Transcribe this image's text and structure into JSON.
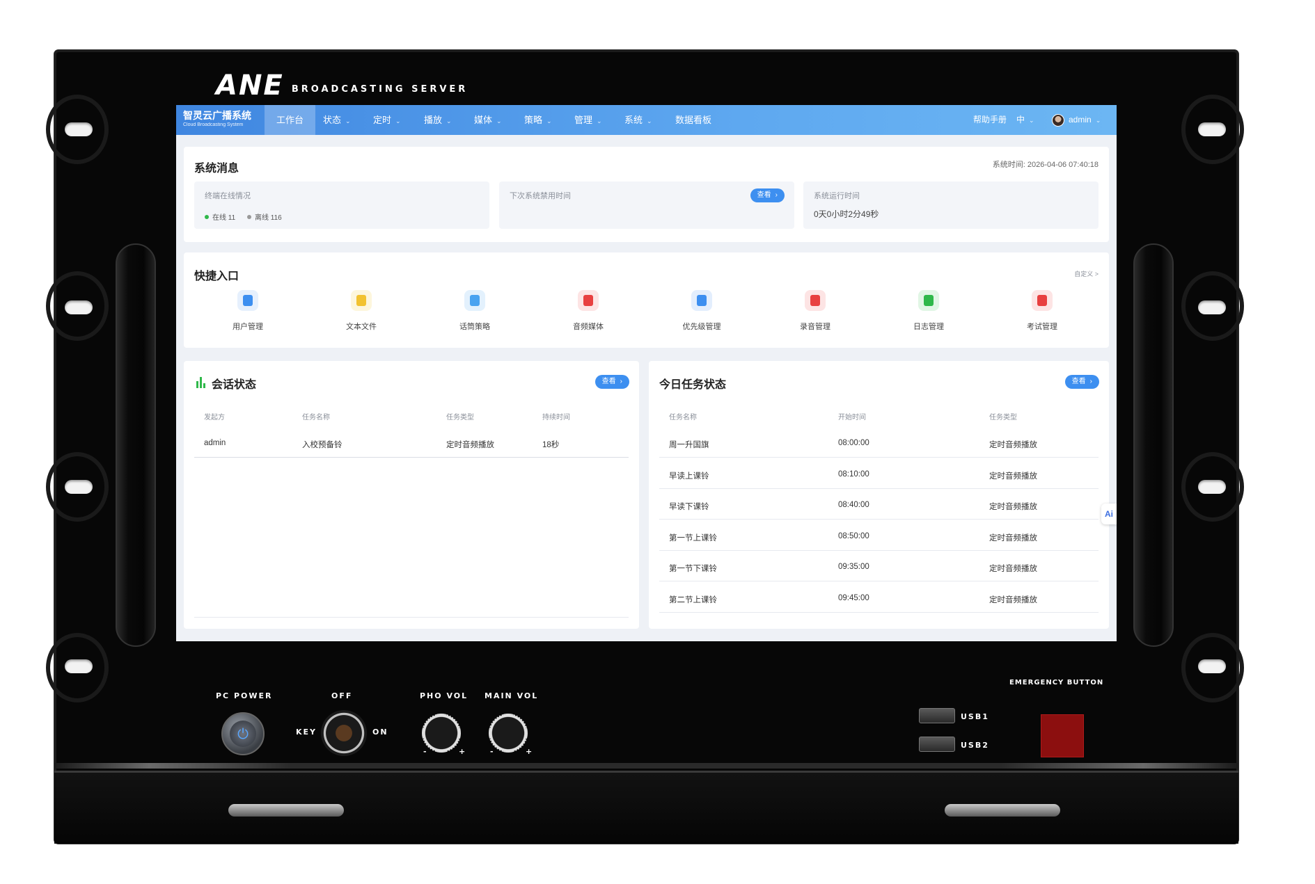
{
  "device": {
    "brand_logo": "ANE",
    "brand_sub": "BROADCASTING SERVER",
    "pc_power": "PC POWER",
    "key_off": "OFF",
    "key_label": "KEY",
    "key_on": "ON",
    "pho_vol": "PHO VOL",
    "main_vol": "MAIN VOL",
    "usb1": "USB1",
    "usb2": "USB2",
    "emergency": "EMERGENCY BUTTON",
    "knob_minus": "-",
    "knob_plus": "+"
  },
  "navbar": {
    "brand_title": "智灵云广播系统",
    "brand_sub": "Cloud Broadcasting System",
    "items": [
      {
        "label": "工作台",
        "active": true
      },
      {
        "label": "状态"
      },
      {
        "label": "定时"
      },
      {
        "label": "播放"
      },
      {
        "label": "媒体"
      },
      {
        "label": "策略"
      },
      {
        "label": "管理"
      },
      {
        "label": "系统"
      },
      {
        "label": "数据看板"
      }
    ],
    "help": "帮助手册",
    "lang": "中",
    "user": "admin"
  },
  "system_msg": {
    "title": "系统消息",
    "time_label": "系统时间: 2026-04-06 07:40:18",
    "terminals_label": "终端在线情况",
    "online": "在线 11",
    "offline": "离线 116",
    "next_disable_label": "下次系统禁用时间",
    "view": "查看",
    "uptime_label": "系统运行时间",
    "uptime_value": "0天0小时2分49秒"
  },
  "quick": {
    "title": "快捷入口",
    "customize": "自定义 >",
    "items": [
      {
        "label": "用户管理",
        "icon": "user-icon",
        "color": "#3d8ff0",
        "bg": "#e6f0fd"
      },
      {
        "label": "文本文件",
        "icon": "text-file-icon",
        "color": "#f2c230",
        "bg": "#fdf6dc"
      },
      {
        "label": "话筒策略",
        "icon": "microphone-policy-icon",
        "color": "#4aa3f0",
        "bg": "#e3f1fd"
      },
      {
        "label": "音频媒体",
        "icon": "audio-media-icon",
        "color": "#e84040",
        "bg": "#fde4e4"
      },
      {
        "label": "优先级管理",
        "icon": "priority-layers-icon",
        "color": "#3d8ff0",
        "bg": "#e3eefd"
      },
      {
        "label": "录音管理",
        "icon": "recording-icon",
        "color": "#e84040",
        "bg": "#fde4e4"
      },
      {
        "label": "日志管理",
        "icon": "log-icon",
        "color": "#2fb84a",
        "bg": "#e1f6e5"
      },
      {
        "label": "考试管理",
        "icon": "exam-icon",
        "color": "#e84040",
        "bg": "#fde4e4"
      }
    ]
  },
  "session": {
    "title": "会话状态",
    "view": "查看",
    "headers": [
      "发起方",
      "任务名称",
      "任务类型",
      "持续时间"
    ],
    "rows": [
      [
        "admin",
        "入校预备铃",
        "定时音频播放",
        "18秒"
      ]
    ]
  },
  "tasks": {
    "title": "今日任务状态",
    "view": "查看",
    "headers": [
      "任务名称",
      "开始时间",
      "任务类型"
    ],
    "rows": [
      [
        "周一升国旗",
        "08:00:00",
        "定时音频播放"
      ],
      [
        "早读上课铃",
        "08:10:00",
        "定时音频播放"
      ],
      [
        "早读下课铃",
        "08:40:00",
        "定时音频播放"
      ],
      [
        "第一节上课铃",
        "08:50:00",
        "定时音频播放"
      ],
      [
        "第一节下课铃",
        "09:35:00",
        "定时音频播放"
      ],
      [
        "第二节上课铃",
        "09:45:00",
        "定时音频播放"
      ]
    ]
  },
  "ai_tab": "Ai"
}
